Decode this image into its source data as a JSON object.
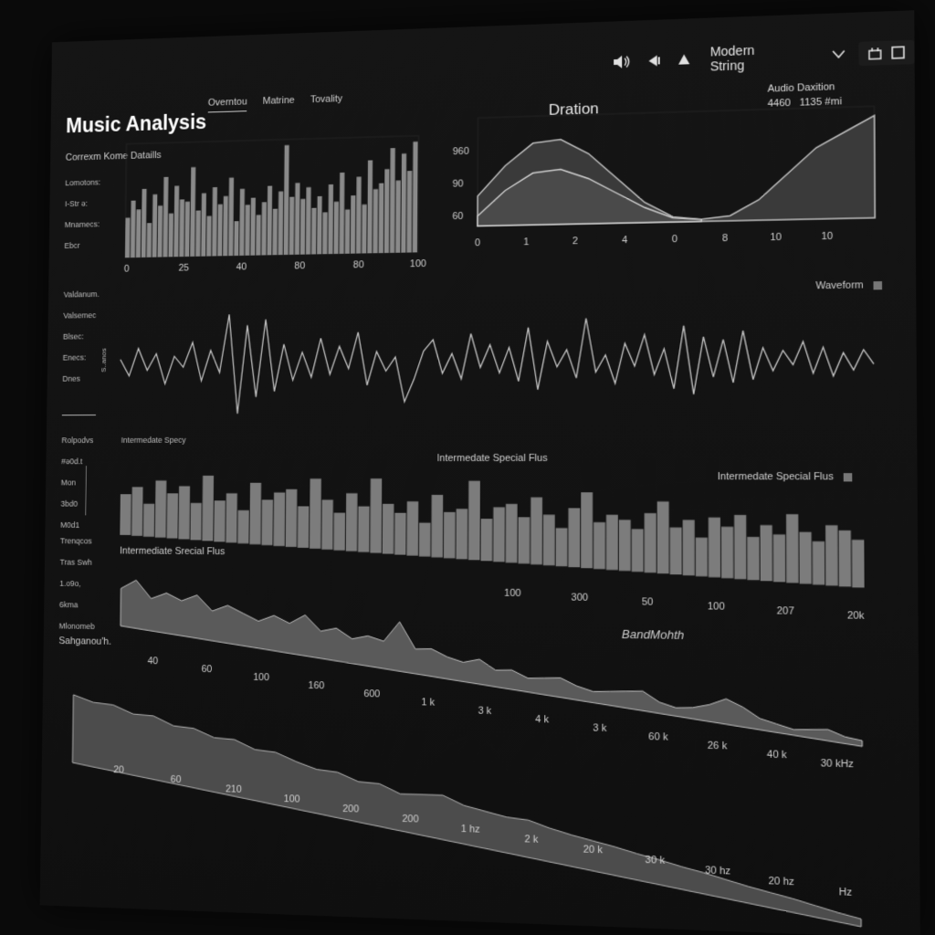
{
  "toolbar": {
    "volume_icon": "speaker-volume-icon",
    "prev_icon": "skip-back-icon",
    "play_icon": "triangle-play-icon",
    "preset": "Modern String",
    "window_icons": [
      "save-icon",
      "square-icon"
    ]
  },
  "header": {
    "title": "Music Analysis",
    "tabs": [
      {
        "label": "Overntou",
        "active": true
      },
      {
        "label": "Matrine",
        "active": false
      },
      {
        "label": "Tovality",
        "active": false
      }
    ]
  },
  "sidebar": {
    "section1_title": "Correxm Kome Dataills",
    "section1_items": [
      "Lomotons:",
      "I-Str ə:",
      "Mnamecs:",
      "Ebcr"
    ],
    "section2_items": [
      "Valdanum.",
      "Valsemec",
      "Blsec:",
      "Enecs:",
      "Dnes"
    ],
    "vertical_label": "S..anos",
    "section3_items": [
      "Rolpodvs",
      "#ə0d.t",
      "Mon",
      "3bd0",
      "M0d1"
    ],
    "section4_items": [
      "Trenqcos",
      "Tras Swh",
      "1.o9o,",
      "6kma",
      "Mlonomeb"
    ],
    "section4_footer": "Sahganou'h."
  },
  "duration_chart": {
    "title": "Dration",
    "audio_label": "Audio Daxition",
    "audio_value_a": "4460",
    "audio_value_b": "1135 #mi"
  },
  "waveform_panel": {
    "label": "Waveform"
  },
  "spectral_panel": {
    "left_label": "Intermedate Specy",
    "center_label": "Intermedate Special Flus",
    "right_label": "Intermedate Special Flus",
    "lower_label": "Intermediate Srecial Flus"
  },
  "bandwidth_panel": {
    "label": "BandMohth"
  },
  "chart_data": [
    {
      "type": "bar",
      "name": "details-spectrum",
      "x_ticks": [
        "0",
        "25",
        "40",
        "80",
        "80",
        "100"
      ],
      "values": [
        0.35,
        0.5,
        0.42,
        0.6,
        0.3,
        0.55,
        0.45,
        0.7,
        0.38,
        0.62,
        0.5,
        0.48,
        0.78,
        0.4,
        0.55,
        0.35,
        0.6,
        0.45,
        0.52,
        0.68,
        0.3,
        0.58,
        0.44,
        0.5,
        0.35,
        0.46,
        0.6,
        0.4,
        0.55,
        0.95,
        0.5,
        0.62,
        0.48,
        0.58,
        0.4,
        0.5,
        0.36,
        0.6,
        0.45,
        0.7,
        0.38,
        0.5,
        0.66,
        0.42,
        0.8,
        0.55,
        0.6,
        0.72,
        0.9,
        0.62,
        0.85,
        0.7,
        0.95
      ],
      "ylim": [
        0,
        1
      ]
    },
    {
      "type": "area",
      "name": "duration",
      "x_ticks": [
        "0",
        "1",
        "2",
        "4",
        "0",
        "8",
        "10",
        "10"
      ],
      "y_ticks": [
        "960",
        "90",
        "60"
      ],
      "upper": [
        0.3,
        0.6,
        0.82,
        0.85,
        0.7,
        0.45,
        0.2,
        0.05,
        0.02,
        0.05,
        0.2,
        0.45,
        0.7,
        0.85,
        1.0
      ],
      "lower": [
        0.1,
        0.35,
        0.52,
        0.55,
        0.45,
        0.3,
        0.15,
        0.04,
        0.02
      ],
      "ylim": [
        0,
        1
      ]
    },
    {
      "type": "line",
      "name": "waveform",
      "values": [
        0.1,
        -0.2,
        0.3,
        -0.1,
        0.2,
        -0.35,
        0.15,
        -0.05,
        0.4,
        -0.3,
        0.25,
        -0.15,
        0.9,
        -0.9,
        0.7,
        -0.6,
        0.8,
        -0.5,
        0.35,
        -0.3,
        0.2,
        -0.25,
        0.45,
        -0.2,
        0.3,
        -0.1,
        0.55,
        -0.4,
        0.2,
        -0.15,
        0.1,
        -0.7,
        -0.3,
        0.2,
        0.4,
        -0.2,
        0.15,
        -0.3,
        0.5,
        -0.1,
        0.3,
        -0.2,
        0.25,
        -0.35,
        0.6,
        -0.5,
        0.35,
        -0.1,
        0.2,
        -0.3,
        0.75,
        -0.2,
        0.1,
        -0.4,
        0.3,
        -0.1,
        0.45,
        -0.25,
        0.2,
        -0.5,
        0.6,
        -0.6,
        0.4,
        -0.3,
        0.35,
        -0.4,
        0.5,
        -0.35,
        0.2,
        -0.2,
        0.15,
        -0.1,
        0.3,
        -0.25,
        0.2,
        -0.3,
        0.1,
        -0.2,
        0.15,
        -0.1
      ],
      "ylim": [
        -1,
        1
      ]
    },
    {
      "type": "bar",
      "name": "spectral-flux",
      "x_ticks": [
        "100",
        "300",
        "50",
        "100",
        "207",
        "20k"
      ],
      "values": [
        0.4,
        0.5,
        0.3,
        0.6,
        0.45,
        0.55,
        0.35,
        0.7,
        0.4,
        0.5,
        0.3,
        0.65,
        0.45,
        0.55,
        0.6,
        0.4,
        0.75,
        0.5,
        0.35,
        0.6,
        0.45,
        0.8,
        0.5,
        0.4,
        0.55,
        0.3,
        0.65,
        0.45,
        0.5,
        0.85,
        0.4,
        0.55,
        0.6,
        0.45,
        0.7,
        0.5,
        0.35,
        0.6,
        0.8,
        0.45,
        0.55,
        0.5,
        0.4,
        0.6,
        0.75,
        0.45,
        0.55,
        0.35,
        0.6,
        0.5,
        0.65,
        0.4,
        0.55,
        0.45,
        0.7,
        0.5,
        0.4,
        0.6,
        0.55,
        0.45
      ],
      "ylim": [
        0,
        1
      ]
    },
    {
      "type": "area",
      "name": "bandwidth",
      "x_ticks": [
        "40",
        "60",
        "100",
        "160",
        "600",
        "1 k",
        "3 k",
        "4 k",
        "3 k",
        "60 k",
        "26 k",
        "40 k",
        "30 kHz"
      ],
      "values": [
        0.7,
        0.9,
        0.6,
        0.75,
        0.65,
        0.8,
        0.55,
        0.7,
        0.6,
        0.5,
        0.65,
        0.55,
        0.75,
        0.5,
        0.6,
        0.45,
        0.55,
        0.5,
        0.9,
        0.45,
        0.5,
        0.4,
        0.35,
        0.45,
        0.3,
        0.35,
        0.25,
        0.3,
        0.35,
        0.25,
        0.2,
        0.25,
        0.3,
        0.35,
        0.2,
        0.15,
        0.2,
        0.3,
        0.45,
        0.35,
        0.2,
        0.15,
        0.1,
        0.15,
        0.2,
        0.12,
        0.1
      ],
      "ylim": [
        0,
        1
      ]
    },
    {
      "type": "area",
      "name": "frequency-spectrum",
      "x_ticks": [
        "20",
        "60",
        "210",
        "100",
        "200",
        "200",
        "1 hz",
        "2 k",
        "20 k",
        "30 k",
        "30 hz",
        "20 hz",
        "Hz"
      ],
      "values": [
        0.95,
        0.9,
        0.92,
        0.85,
        0.88,
        0.8,
        0.82,
        0.75,
        0.78,
        0.7,
        0.72,
        0.65,
        0.6,
        0.62,
        0.55,
        0.58,
        0.5,
        0.55,
        0.6,
        0.52,
        0.5,
        0.48,
        0.5,
        0.45,
        0.42,
        0.4,
        0.38,
        0.35,
        0.33,
        0.3,
        0.28,
        0.25,
        0.22,
        0.2,
        0.18,
        0.15,
        0.12,
        0.1
      ],
      "ylim": [
        0,
        1
      ]
    }
  ]
}
